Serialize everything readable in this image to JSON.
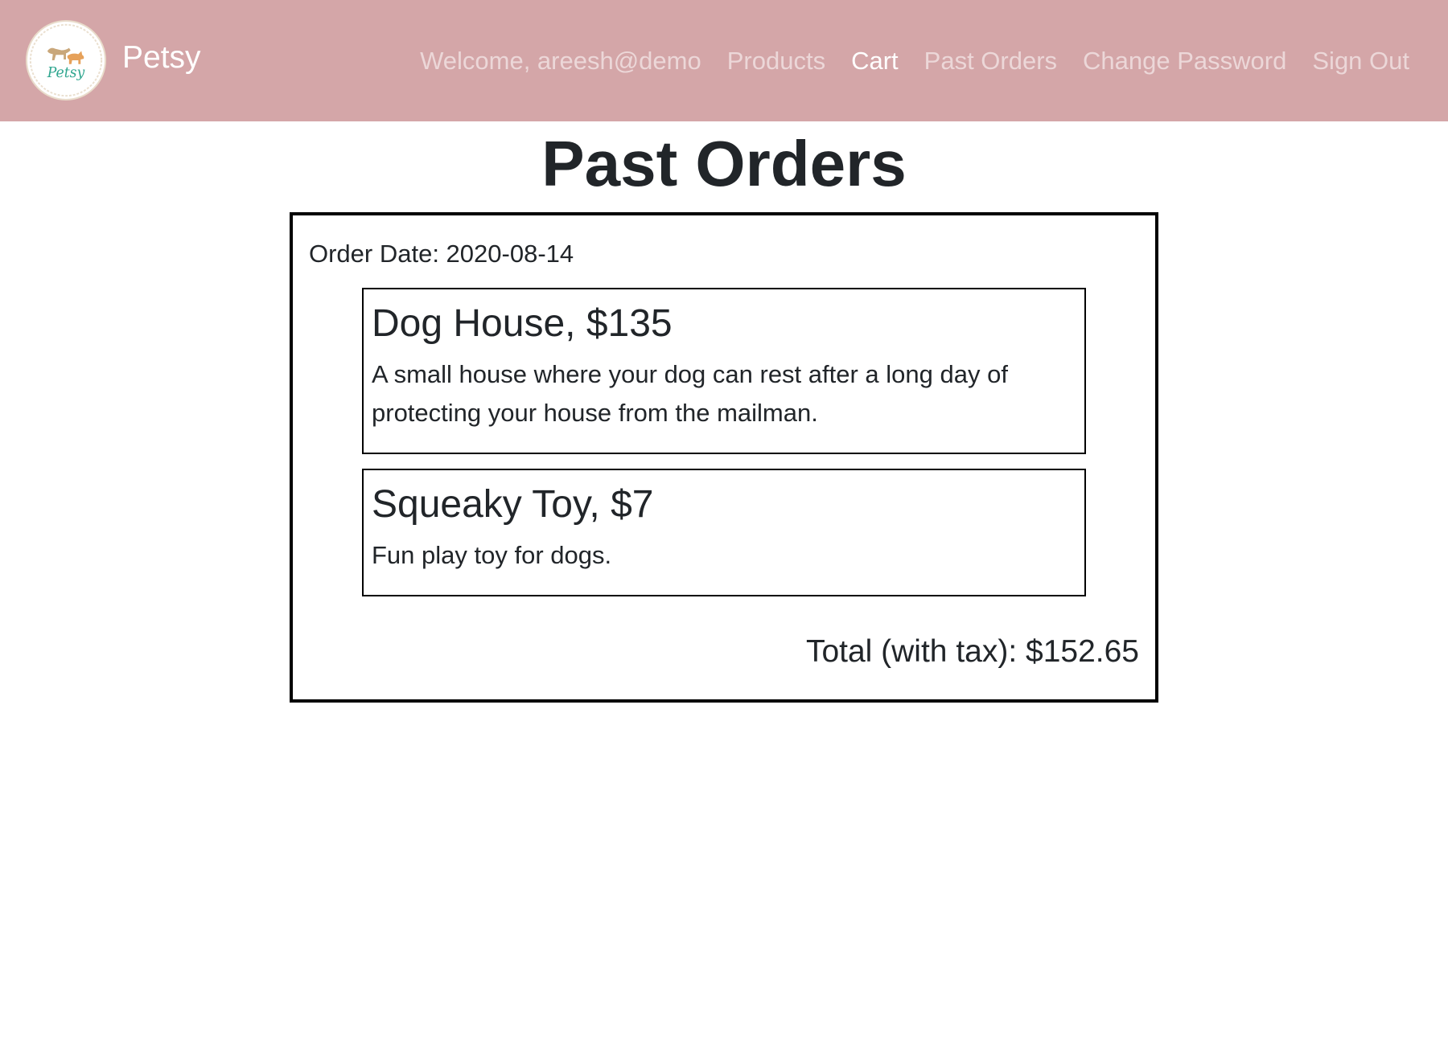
{
  "navbar": {
    "brand": "Petsy",
    "logo_text": "Petsy",
    "welcome": "Welcome, areesh@demo",
    "links": [
      "Products",
      "Cart",
      "Past Orders",
      "Change Password",
      "Sign Out"
    ],
    "active_link": "Cart",
    "background_color": "#d4a6a8"
  },
  "page": {
    "title": "Past Orders"
  },
  "orders": [
    {
      "date_label": "Order Date: 2020-08-14",
      "items": [
        {
          "title": "Dog House, $135",
          "description": "A small house where your dog can rest after a long day of protecting your house from the mailman."
        },
        {
          "title": "Squeaky Toy, $7",
          "description": "Fun play toy for dogs."
        }
      ],
      "total_label": "Total (with tax): $152.65"
    }
  ]
}
